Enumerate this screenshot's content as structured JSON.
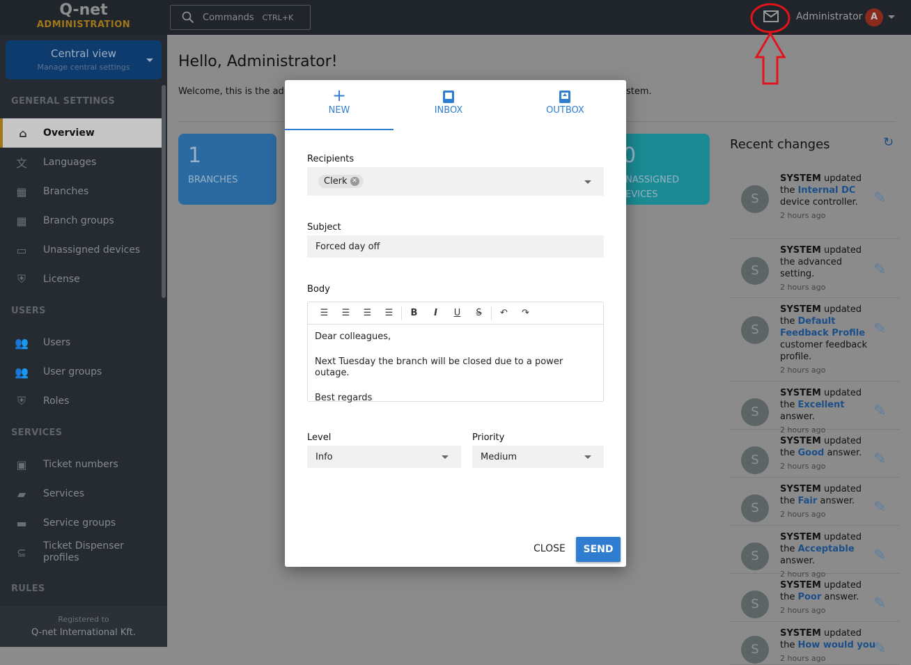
{
  "header": {
    "logo_top": "Q-net",
    "logo_bottom": "ADMINISTRATION",
    "commands_placeholder": "Commands",
    "commands_shortcut": "CTRL+K",
    "user_name": "Administrator",
    "avatar_initial": "A"
  },
  "sidebar": {
    "context": {
      "title": "Central view",
      "subtitle": "Manage central settings"
    },
    "sections": [
      {
        "label": "GENERAL SETTINGS",
        "items": [
          {
            "label": "Overview",
            "icon": "home-icon",
            "active": true
          },
          {
            "label": "Languages",
            "icon": "translate-icon"
          },
          {
            "label": "Branches",
            "icon": "building-icon"
          },
          {
            "label": "Branch groups",
            "icon": "buildings-icon"
          },
          {
            "label": "Unassigned devices",
            "icon": "devices-icon"
          },
          {
            "label": "License",
            "icon": "shield-icon"
          }
        ]
      },
      {
        "label": "USERS",
        "items": [
          {
            "label": "Users",
            "icon": "users-icon"
          },
          {
            "label": "User groups",
            "icon": "user-groups-icon"
          },
          {
            "label": "Roles",
            "icon": "shield-check-icon"
          }
        ]
      },
      {
        "label": "SERVICES",
        "items": [
          {
            "label": "Ticket numbers",
            "icon": "ticket-number-icon"
          },
          {
            "label": "Services",
            "icon": "tag-icon"
          },
          {
            "label": "Service groups",
            "icon": "folder-icon"
          },
          {
            "label": "Ticket Dispenser profiles",
            "icon": "dispenser-icon"
          }
        ]
      },
      {
        "label": "RULES",
        "items": []
      }
    ],
    "registered_label": "Registered to",
    "registered_to": "Q-net International Kft."
  },
  "main": {
    "greeting": "Hello, Administrator!",
    "welcome_start": "Welcome, this is the adm",
    "welcome_end": "stem.",
    "cards": [
      {
        "value": "1",
        "label": "BRANCHES",
        "color": "#2a6aa0"
      },
      {
        "value": "0",
        "label": "NASSIGNED\nEVICES",
        "color": "#1b8a93"
      }
    ]
  },
  "recent": {
    "title": "Recent changes",
    "time": "2 hours ago",
    "items": [
      {
        "actor": "SYSTEM",
        "pre": " updated the ",
        "link": "Internal DC",
        "post": " device controller."
      },
      {
        "actor": "SYSTEM",
        "pre": " updated the advanced setting.",
        "link": "",
        "post": ""
      },
      {
        "actor": "SYSTEM",
        "pre": " updated the ",
        "link": "Default Feedback Profile",
        "post": " customer feedback profile."
      },
      {
        "actor": "SYSTEM",
        "pre": " updated the ",
        "link": "Excellent",
        "post": " answer."
      },
      {
        "actor": "SYSTEM",
        "pre": " updated the ",
        "link": "Good",
        "post": " answer."
      },
      {
        "actor": "SYSTEM",
        "pre": " updated the ",
        "link": "Fair",
        "post": " answer."
      },
      {
        "actor": "SYSTEM",
        "pre": " updated the ",
        "link": "Acceptable",
        "post": " answer."
      },
      {
        "actor": "SYSTEM",
        "pre": " updated the ",
        "link": "Poor",
        "post": " answer."
      },
      {
        "actor": "SYSTEM",
        "pre": " updated the ",
        "link": "How would you",
        "post": ""
      }
    ]
  },
  "modal": {
    "tabs": [
      {
        "label": "NEW",
        "icon": "plus-icon"
      },
      {
        "label": "INBOX",
        "icon": "inbox-icon"
      },
      {
        "label": "OUTBOX",
        "icon": "outbox-icon"
      }
    ],
    "recipients_label": "Recipients",
    "recipient_chip": "Clerk",
    "subject_label": "Subject",
    "subject_value": "Forced day off",
    "body_label": "Body",
    "body_lines": [
      "Dear colleagues,",
      "Next Tuesday the branch will be closed due to a power outage.",
      "Best regards"
    ],
    "level_label": "Level",
    "level_value": "Info",
    "priority_label": "Priority",
    "priority_value": "Medium",
    "close_label": "CLOSE",
    "send_label": "SEND"
  }
}
